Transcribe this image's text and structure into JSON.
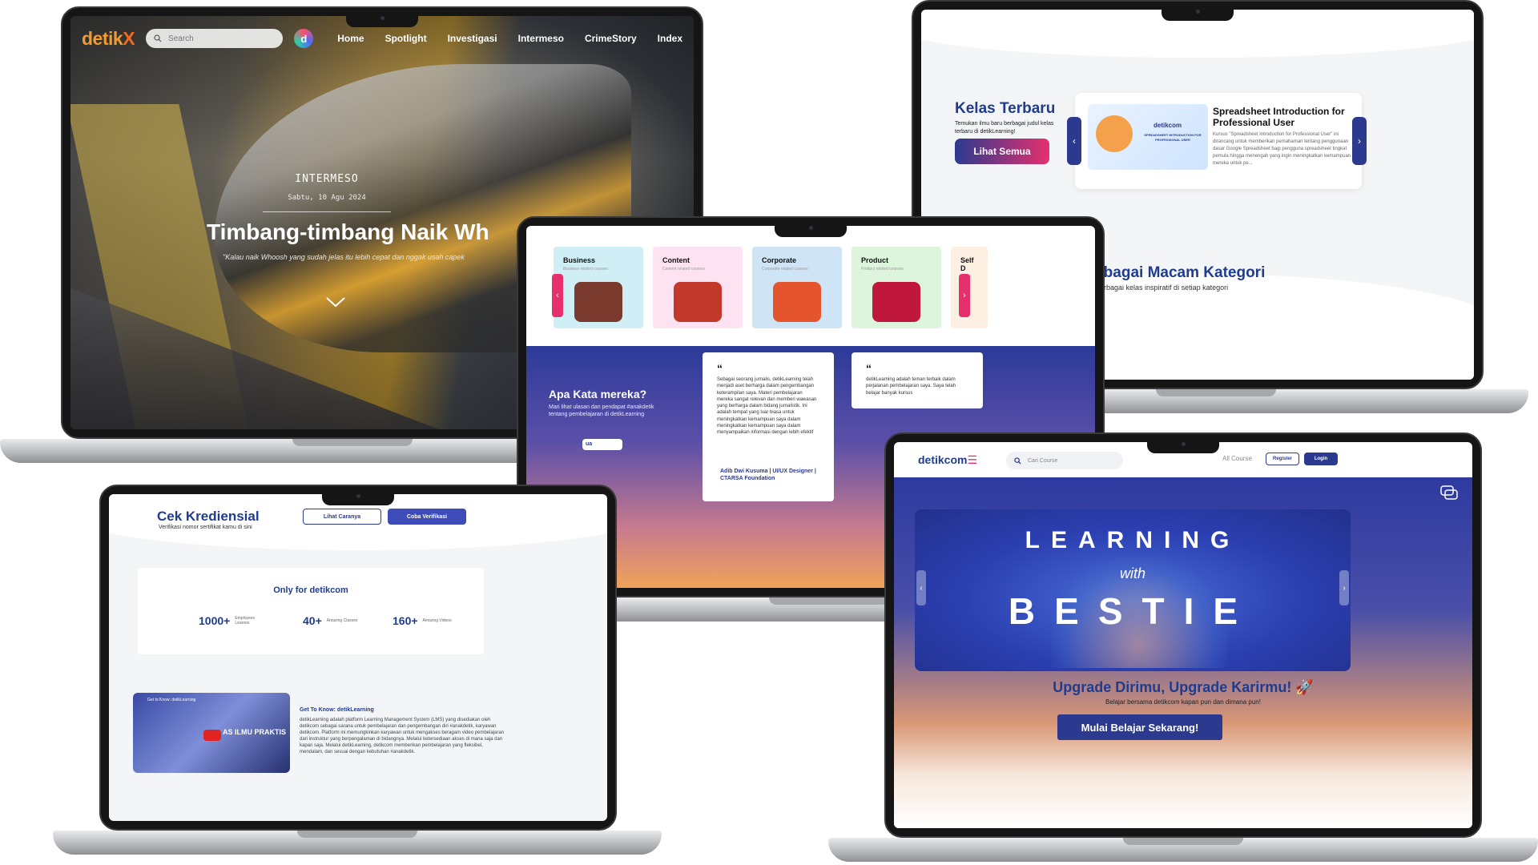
{
  "detikx": {
    "brand": "detik",
    "brand_x": "X",
    "search_placeholder": "Search",
    "badge": "d",
    "nav": [
      "Home",
      "Spotlight",
      "Investigasi",
      "Intermeso",
      "CrimeStory",
      "Index"
    ],
    "hero": {
      "kicker": "INTERMESO",
      "date": "Sabtu, 10 Agu 2024",
      "title": "Timbang-timbang Naik Wh",
      "quote": "\"Kalau naik Whoosh yang sudah jelas itu lebih cepat dan nggak usah capek"
    }
  },
  "kelas": {
    "title": "Kelas Terbaru",
    "desc": "Temukan ilmu baru berbagai judul kelas terbaru di detikLearning!",
    "button": "Lihat Semua",
    "course": {
      "thumb_brand": "detikcom",
      "thumb_text": "SPREADSHEET INTRODUCTION FOR PROFESSIONAL USER",
      "title": "Spreadsheet Introduction for Professional User",
      "desc": "Kursus \"Spreadsheet Introduction for Professional User\" ini dirancang untuk memberikan pemahaman tentang penggunaan dasar Google Spreadsheet bagi pengguna spreadsheet tingkat pemula hingga menengah yang ingin meningkatkan kemampuan mereka untuk pe..."
    },
    "kategori_title": "Berbagai Macam Kategori",
    "kategori_desc": "splor berbagai kelas inspiratif di setiap kategori"
  },
  "categories": {
    "items": [
      {
        "name": "Business",
        "sub": "Business related courses",
        "color": "#cfeef6",
        "obj": "#7a3b2e"
      },
      {
        "name": "Content",
        "sub": "Content related courses",
        "color": "#fde3f1",
        "obj": "#c0392b"
      },
      {
        "name": "Corporate",
        "sub": "Corporate related courses",
        "color": "#cfe4f5",
        "obj": "#e4542d"
      },
      {
        "name": "Product",
        "sub": "Product related courses",
        "color": "#dcf5dc",
        "obj": "#c0183c"
      },
      {
        "name": "Self D",
        "sub": "Self d",
        "color": "#fdf0e3",
        "obj": "#f4c36b"
      }
    ],
    "testimonial": {
      "title": "Apa Kata mereka?",
      "desc": "Mari lihat ulasan dan pendapat #anakdetik tentang pembelajaran di detikLearning",
      "button": "ua"
    },
    "quotes": [
      {
        "mark": "“",
        "text": "Sebagai seorang jurnalis, detikLearning telah menjadi aset berharga dalam pengembangan keterampilan saya. Materi pembelajaran mereka sangat relevan dan memberi wawasan yang berharga dalam bidang jurnalistik. Ini adalah tempat yang luar biasa untuk meningkatkan kemampuan saya dalam meningkatkan kemampuan saya dalam menyampaikan informasi dengan lebih efektif",
        "author": "Adib Dwi Kusuma | UI/UX Designer | CTARSA Foundation"
      },
      {
        "mark": "“",
        "text": "detikLearning adalah teman terbaik dalam perjalanan pembelajaran saya. Saya telah belajar banyak kursus",
        "author": ""
      }
    ]
  },
  "kredensial": {
    "title": "Cek Krediensial",
    "desc": "Verifikasi nomor sertifikat kamu di sini",
    "btn_outline": "Lihat Caranya",
    "btn_solid": "Coba Verifikasi",
    "stats_head": "Only for detikcom",
    "stats": [
      {
        "n": "1000+",
        "l": "Employees Learnes"
      },
      {
        "n": "40+",
        "l": "Amazing Classes"
      },
      {
        "n": "160+",
        "l": "Amazing Videos"
      }
    ],
    "video_label": "Get to Know: detikLearning",
    "video_text": "AS ILMU PRAKTIS",
    "gtk_title": "Get To Know: detikLearning",
    "gtk_desc": "detikLearning adalah platform Learning Management System (LMS) yang disediakan oleh detikcom sebagai sarana untuk pembelajaran dan pengembangan diri #anakdetik, karyawan detikcom. Platform ini memungkinkan karyawan untuk mengakses beragam video pembelajaran dari instruktur yang berpengalaman di bidangnya. Melalui ketersediaan akses di mana saja dan kapan saja. Melalui detikLearning, detikcom memberikan pembelajaran yang fleksibel, mendalam, dan sesuai dengan kebutuhan #anakdetik."
  },
  "learning": {
    "brand": "detikcom",
    "search_placeholder": "Cari Course",
    "all_course": "All Course",
    "register": "Register",
    "login": "Login",
    "banner_line1": "LEARNING",
    "banner_with": "with",
    "banner_line2": "BESTIE",
    "upgrade_title": "Upgrade Dirimu, Upgrade Karirmu! 🚀",
    "upgrade_desc": "Belajar bersama detikcom kapan pun dan dimana pun!",
    "cta": "Mulai Belajar Sekarang!"
  }
}
